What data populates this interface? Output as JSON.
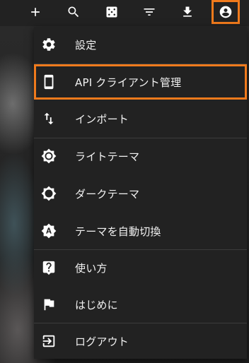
{
  "toolbar": {
    "buttons": [
      {
        "icon": "plus-icon"
      },
      {
        "icon": "search-icon"
      },
      {
        "icon": "dice-icon"
      },
      {
        "icon": "filter-icon"
      },
      {
        "icon": "download-icon"
      },
      {
        "icon": "account-circle-icon",
        "highlighted": true
      }
    ]
  },
  "menu": {
    "items": [
      {
        "label": "設定",
        "icon": "gear-icon"
      },
      {
        "label": "API クライアント管理",
        "icon": "phone-icon",
        "highlighted": true
      },
      {
        "label": "インポート",
        "icon": "import-arrows-icon"
      },
      {
        "label": "ライトテーマ",
        "icon": "light-theme-icon"
      },
      {
        "label": "ダークテーマ",
        "icon": "dark-theme-icon"
      },
      {
        "label": "テーマを自動切換",
        "icon": "auto-theme-icon"
      },
      {
        "label": "使い方",
        "icon": "help-icon"
      },
      {
        "label": "はじめに",
        "icon": "flag-icon"
      },
      {
        "label": "ログアウト",
        "icon": "logout-icon"
      }
    ]
  },
  "colors": {
    "highlight": "#f07a1c",
    "menu_bg": "#222222",
    "text": "#f2f2f2"
  }
}
